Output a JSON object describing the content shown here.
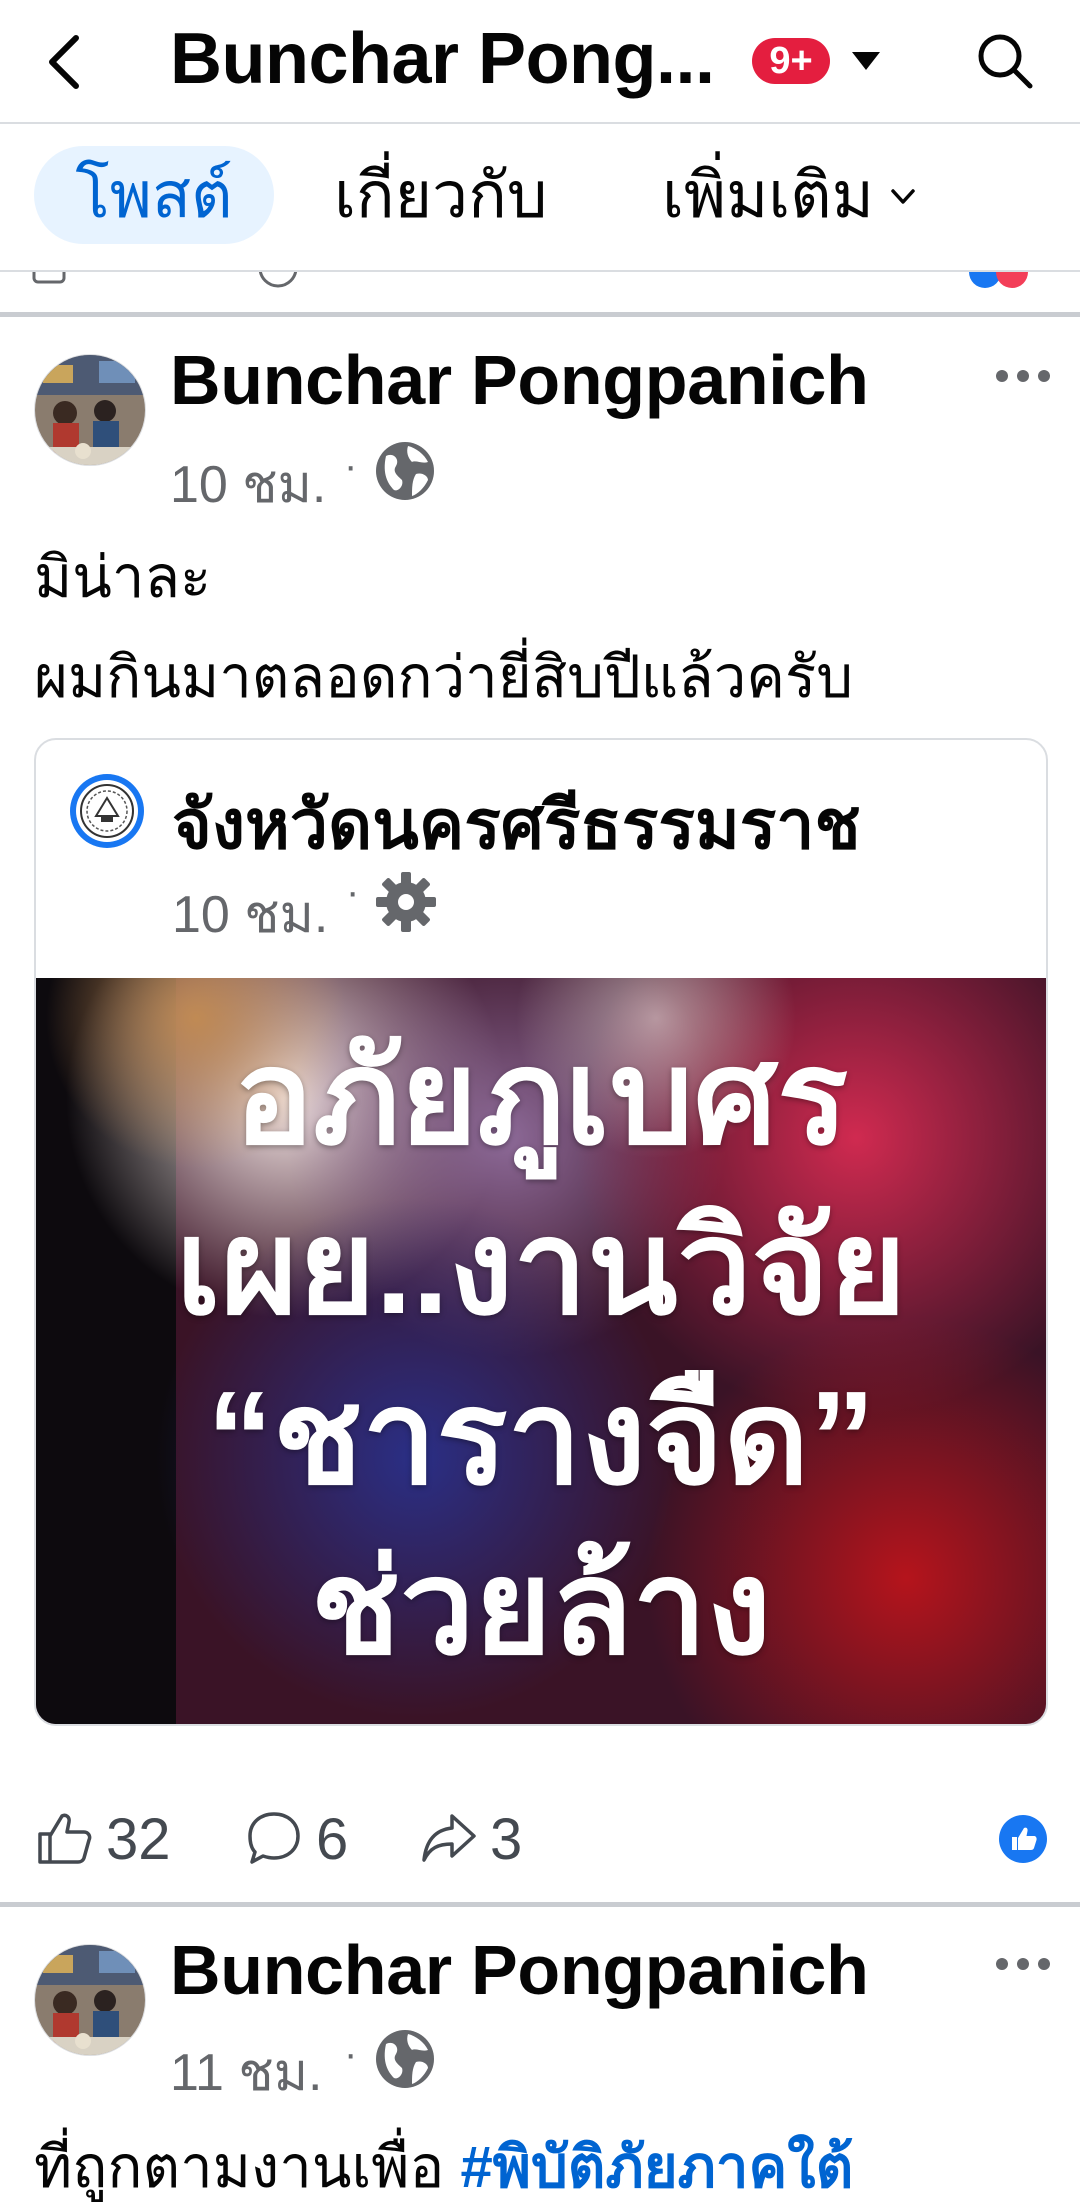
{
  "header": {
    "title": "Bunchar Pong...",
    "notification_badge": "9+"
  },
  "tabs": [
    {
      "label": "โพสต์",
      "active": true
    },
    {
      "label": "เกี่ยวกับ"
    },
    {
      "label": "เพิ่มเติม"
    }
  ],
  "posts": [
    {
      "author": "Bunchar Pongpanich",
      "time": "10 ชม.",
      "privacy_icon": "globe-icon",
      "text_lines": [
        "มิน่าละ",
        "ผมกินมาตลอดกว่ายี่สิบปีแล้วครับ"
      ],
      "shared": {
        "page_name": "จังหวัดนครศรีธรรมราช",
        "time": "10 ชม.",
        "privacy_icon": "gear-icon",
        "image_text_lines": [
          "อภัยภูเบศร",
          "เผย..งานวิจัย",
          "“ชารางจืด”",
          "ช่วยล้าง"
        ]
      },
      "stats": {
        "likes": "32",
        "comments": "6",
        "shares": "3"
      }
    },
    {
      "author": "Bunchar Pongpanich",
      "time": "11 ชม.",
      "privacy_icon": "globe-icon",
      "text_prefix": "ที่ถูกตามงานเพื่อ ",
      "hashtag": "#พิบัติภัยภาคใต้"
    }
  ],
  "colors": {
    "accent": "#0064d1",
    "active_tab_bg": "#e7f3ff",
    "badge": "#e41e3f",
    "like_blue": "#1877f2",
    "meta_gray": "#65676b",
    "separator": "#c9ccd1"
  }
}
